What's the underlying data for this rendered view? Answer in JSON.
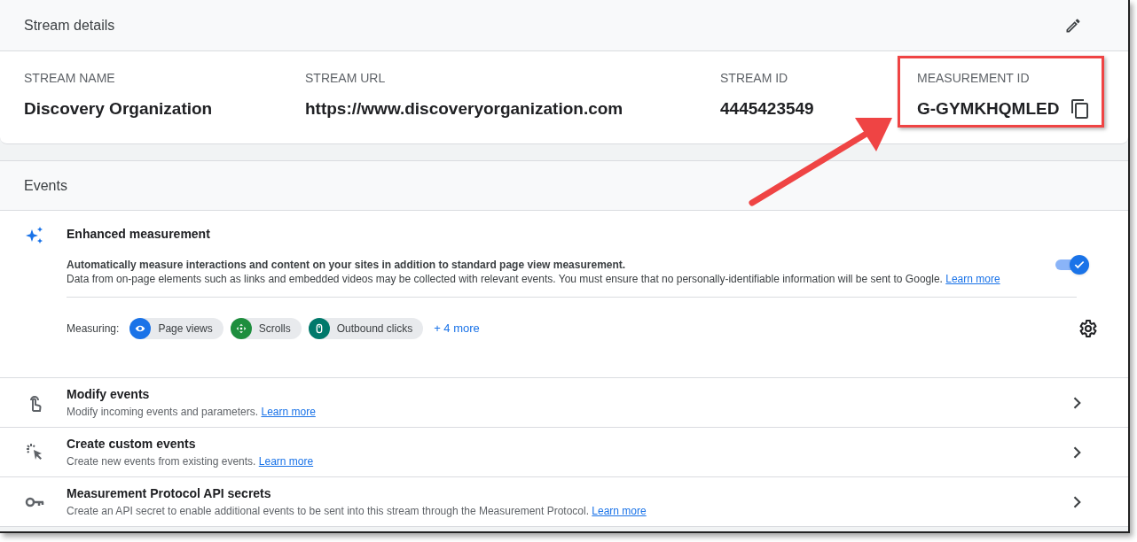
{
  "stream_details": {
    "title": "Stream details",
    "fields": [
      {
        "label": "STREAM NAME",
        "value": "Discovery Organization"
      },
      {
        "label": "STREAM URL",
        "value": "https://www.discoveryorganization.com"
      },
      {
        "label": "STREAM ID",
        "value": "4445423549"
      },
      {
        "label": "MEASUREMENT ID",
        "value": "G-GYMKHQMLED",
        "kind": "copyable",
        "highlighted": true
      }
    ]
  },
  "events": {
    "title": "Events",
    "enhanced_measurement": {
      "title": "Enhanced measurement",
      "description": "Automatically measure interactions and content on your sites in addition to standard page view measurement.",
      "note": "Data from on-page elements such as links and embedded videos may be collected with relevant events. You must ensure that no personally-identifiable information will be sent to Google.",
      "link": "Learn more",
      "on": true,
      "measuring_label": "Measuring:",
      "chips": [
        {
          "kind": "eye",
          "label": "Page views",
          "color": "#1a73e8"
        },
        {
          "kind": "scroll",
          "label": "Scrolls",
          "color": "#1e8e3e"
        },
        {
          "kind": "mouse",
          "label": "Outbound clicks",
          "color": "#00796b"
        }
      ],
      "more": "+ 4 more"
    },
    "rows": [
      {
        "kind": "touch",
        "title": "Modify events",
        "description": "Modify incoming events and parameters.",
        "link": "Learn more"
      },
      {
        "kind": "cursor",
        "title": "Create custom events",
        "description": "Create new events from existing events.",
        "link": "Learn more"
      },
      {
        "kind": "key",
        "title": "Measurement Protocol API secrets",
        "description": "Create an API secret to enable additional events to be sent into this stream through the Measurement Protocol.",
        "link": "Learn more"
      }
    ]
  }
}
